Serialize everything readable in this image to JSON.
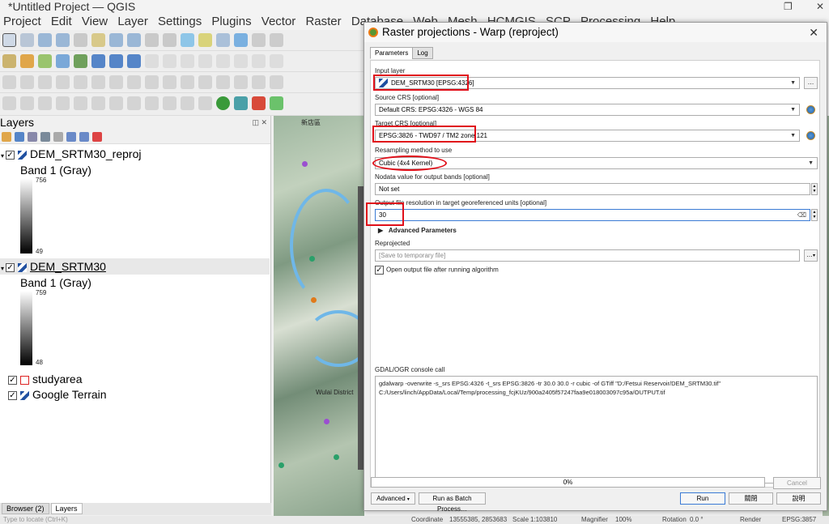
{
  "app": {
    "title": "*Untitled Project — QGIS",
    "menu": [
      "Project",
      "Edit",
      "View",
      "Layer",
      "Settings",
      "Plugins",
      "Vector",
      "Raster",
      "Database",
      "Web",
      "Mesh",
      "HCMGIS",
      "SCP",
      "Processing",
      "Help"
    ]
  },
  "layers_panel": {
    "title": "Layers",
    "layers": [
      {
        "name": "DEM_SRTM30_reproj",
        "band": "Band 1 (Gray)",
        "max": "756",
        "min": "49"
      },
      {
        "name": "DEM_SRTM30",
        "band": "Band 1 (Gray)",
        "max": "759",
        "min": "48"
      },
      {
        "name": "studyarea"
      },
      {
        "name": "Google Terrain"
      }
    ],
    "bottom_tabs": [
      "Browser (2)",
      "Layers"
    ]
  },
  "map": {
    "labels": [
      "新店區",
      "Wulai District"
    ]
  },
  "status": {
    "search_placeholder": "Type to locate (Ctrl+K)",
    "coordinate_label": "Coordinate",
    "coordinate": "13555385, 2853683",
    "scale_label": "Scale",
    "scale": "1:103810",
    "magnifier_label": "Magnifier",
    "magnifier": "100%",
    "rotation_label": "Rotation",
    "rotation": "0.0 °",
    "render_label": "Render",
    "crs": "EPSG:3857"
  },
  "dialog": {
    "title": "Raster projections - Warp (reproject)",
    "tabs": [
      "Parameters",
      "Log"
    ],
    "input_layer_label": "Input layer",
    "input_layer": "DEM_SRTM30 [EPSG:4326]",
    "source_crs_label": "Source CRS [optional]",
    "source_crs": "Default CRS: EPSG:4326 - WGS 84",
    "target_crs_label": "Target CRS [optional]",
    "target_crs": "EPSG:3826 - TWD97 / TM2 zone 121",
    "resampling_label": "Resampling method to use",
    "resampling": "Cubic (4x4 Kernel)",
    "nodata_label": "Nodata value for output bands [optional]",
    "nodata": "Not set",
    "resolution_label": "Output file resolution in target georeferenced units [optional]",
    "resolution": "30",
    "advanced_label": "Advanced Parameters",
    "reprojected_label": "Reprojected",
    "reprojected_placeholder": "[Save to temporary file]",
    "open_output_label": "Open output file after running algorithm",
    "console_label": "GDAL/OGR console call",
    "console_text": "gdalwarp -overwrite -s_srs EPSG:4326 -t_srs EPSG:3826 -tr 30.0 30.0 -r cubic -of GTiff \"D:/Fetsui Reservoir/DEM_SRTM30.tif\" C:/Users/linch/AppData/Local/Temp/processing_fcjKUz/900a2405f57247faa9e018003097c95a/OUTPUT.tif",
    "progress": "0%",
    "cancel": "Cancel",
    "advanced_button": "Advanced",
    "batch_button": "Run as Batch Process…",
    "run": "Run",
    "close": "關閉",
    "help": "說明",
    "ellipsis": "…"
  }
}
